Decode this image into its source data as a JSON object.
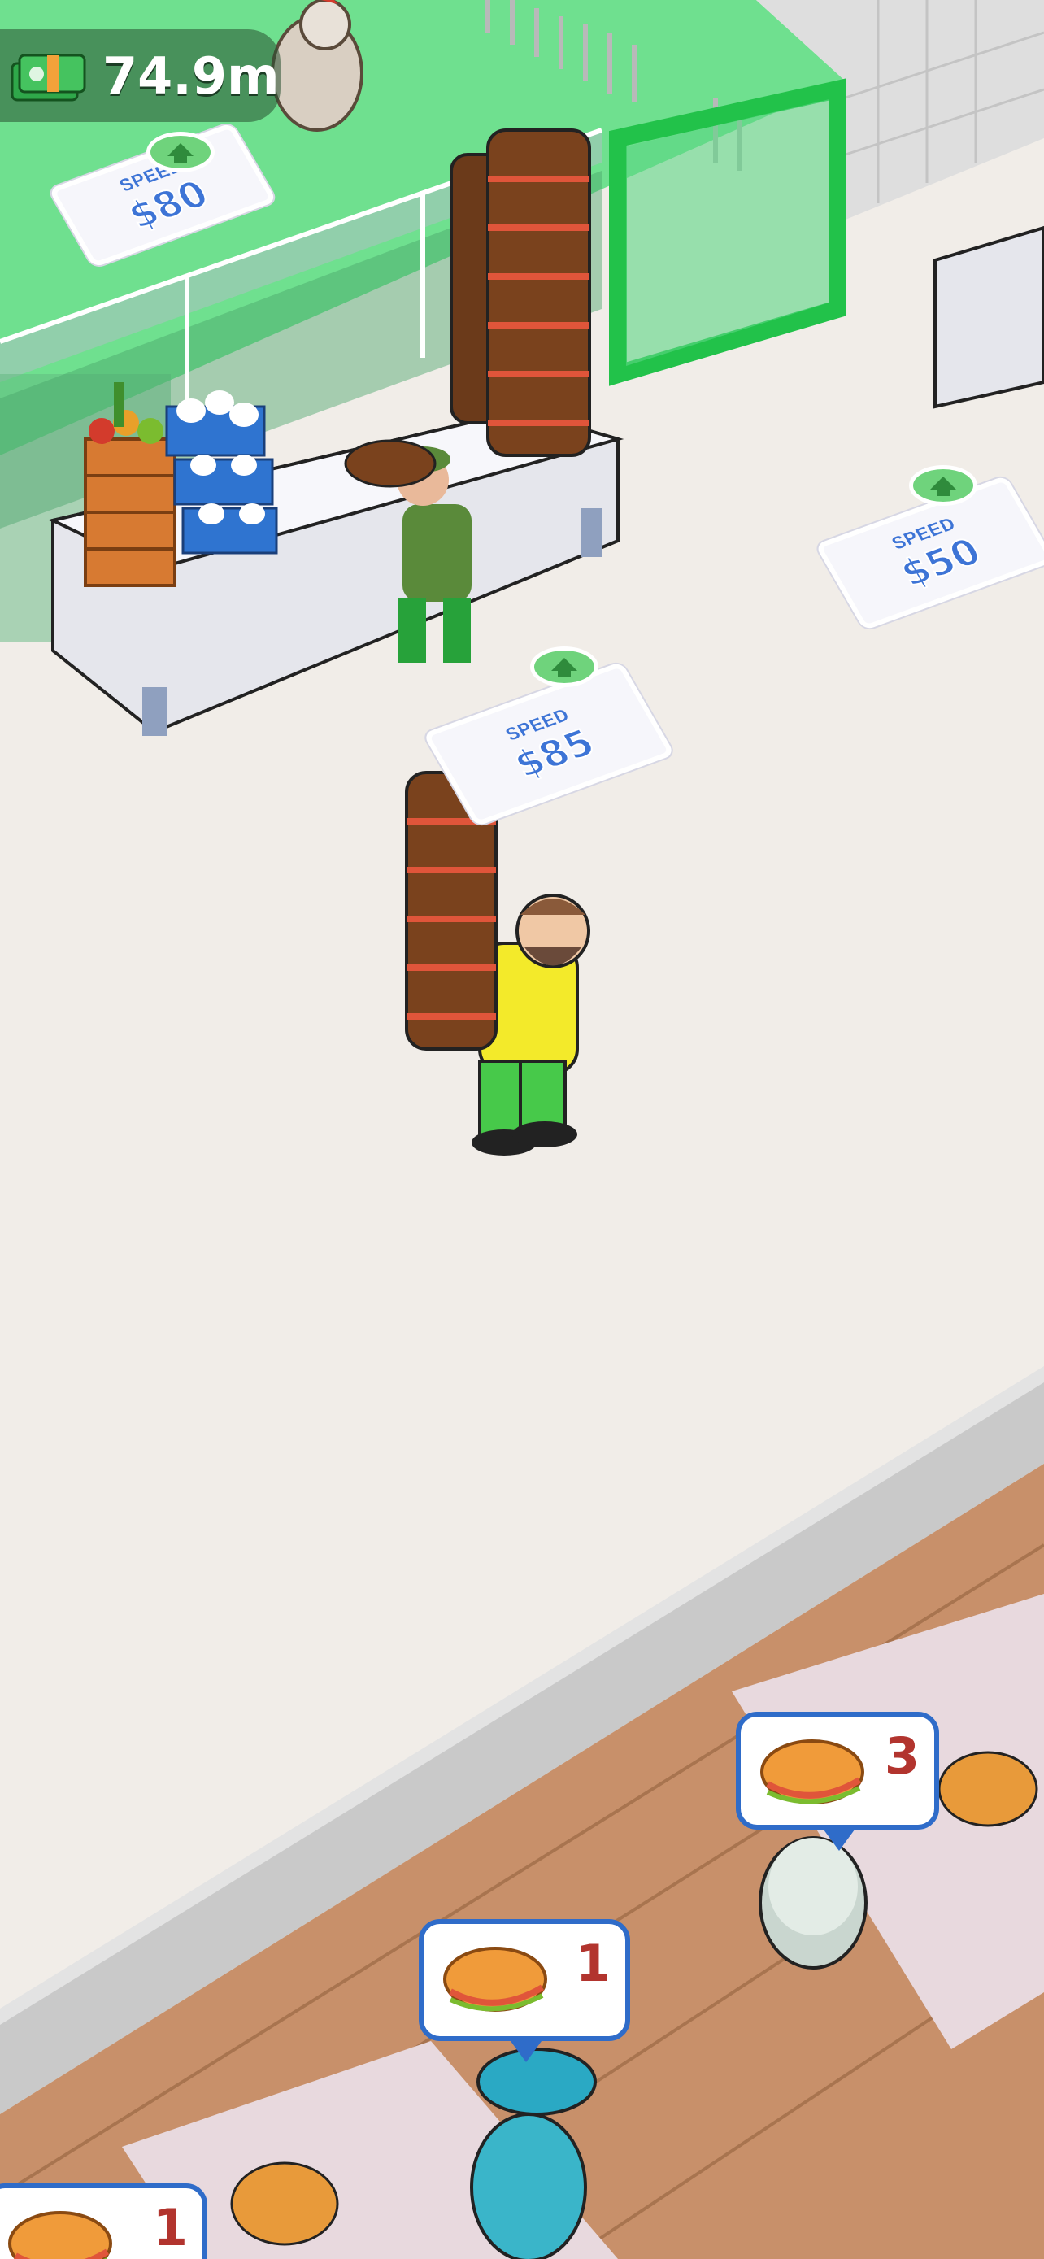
{
  "hud": {
    "money_value": "74.9m",
    "money_icon": "cash-stack-icon"
  },
  "upgrade_pads": [
    {
      "label": "SPEED",
      "price": "$80",
      "icon": "arrow-up-icon"
    },
    {
      "label": "SPEED",
      "price": "$85",
      "icon": "arrow-up-icon"
    },
    {
      "label": "SPEED",
      "price": "$50",
      "icon": "arrow-up-icon"
    }
  ],
  "orders": [
    {
      "item": "sandwich-icon",
      "count": "3"
    },
    {
      "item": "sandwich-icon",
      "count": "1"
    },
    {
      "item": "sandwich-icon",
      "count": "1"
    }
  ],
  "colors": {
    "floor": "#f1ede8",
    "kitchen_floor": "#6fe08f",
    "wood_floor": "#c8906a",
    "accent_blue": "#2f6cc9",
    "count_red": "#b2342e",
    "fence_green": "#22c24a"
  }
}
